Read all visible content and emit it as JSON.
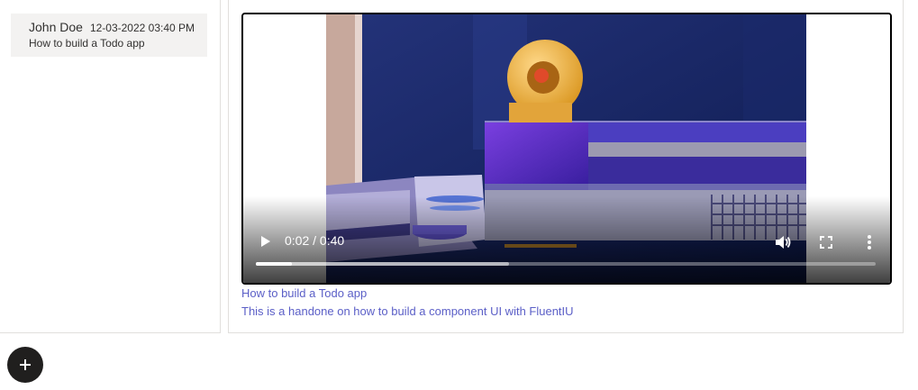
{
  "list": {
    "items": [
      {
        "author": "John Doe",
        "date": "12-03-2022 03:40 PM",
        "title": "How to build a Todo app"
      }
    ]
  },
  "video": {
    "time": "0:02 / 0:40",
    "played_fraction": 0.058,
    "buffered_fraction": 0.408,
    "icons": {
      "play": "play-icon",
      "volume": "volume-icon",
      "fullscreen": "fullscreen-icon",
      "more": "more-options-icon"
    }
  },
  "post": {
    "title": "How to build a Todo app",
    "description": "This is a handone on how to build a component UI with FluentIU"
  },
  "fab": {
    "icon": "plus-icon"
  },
  "colors": {
    "link": "#5b5fc7",
    "fab": "#201f1e",
    "list_bg": "#f3f2f1"
  }
}
